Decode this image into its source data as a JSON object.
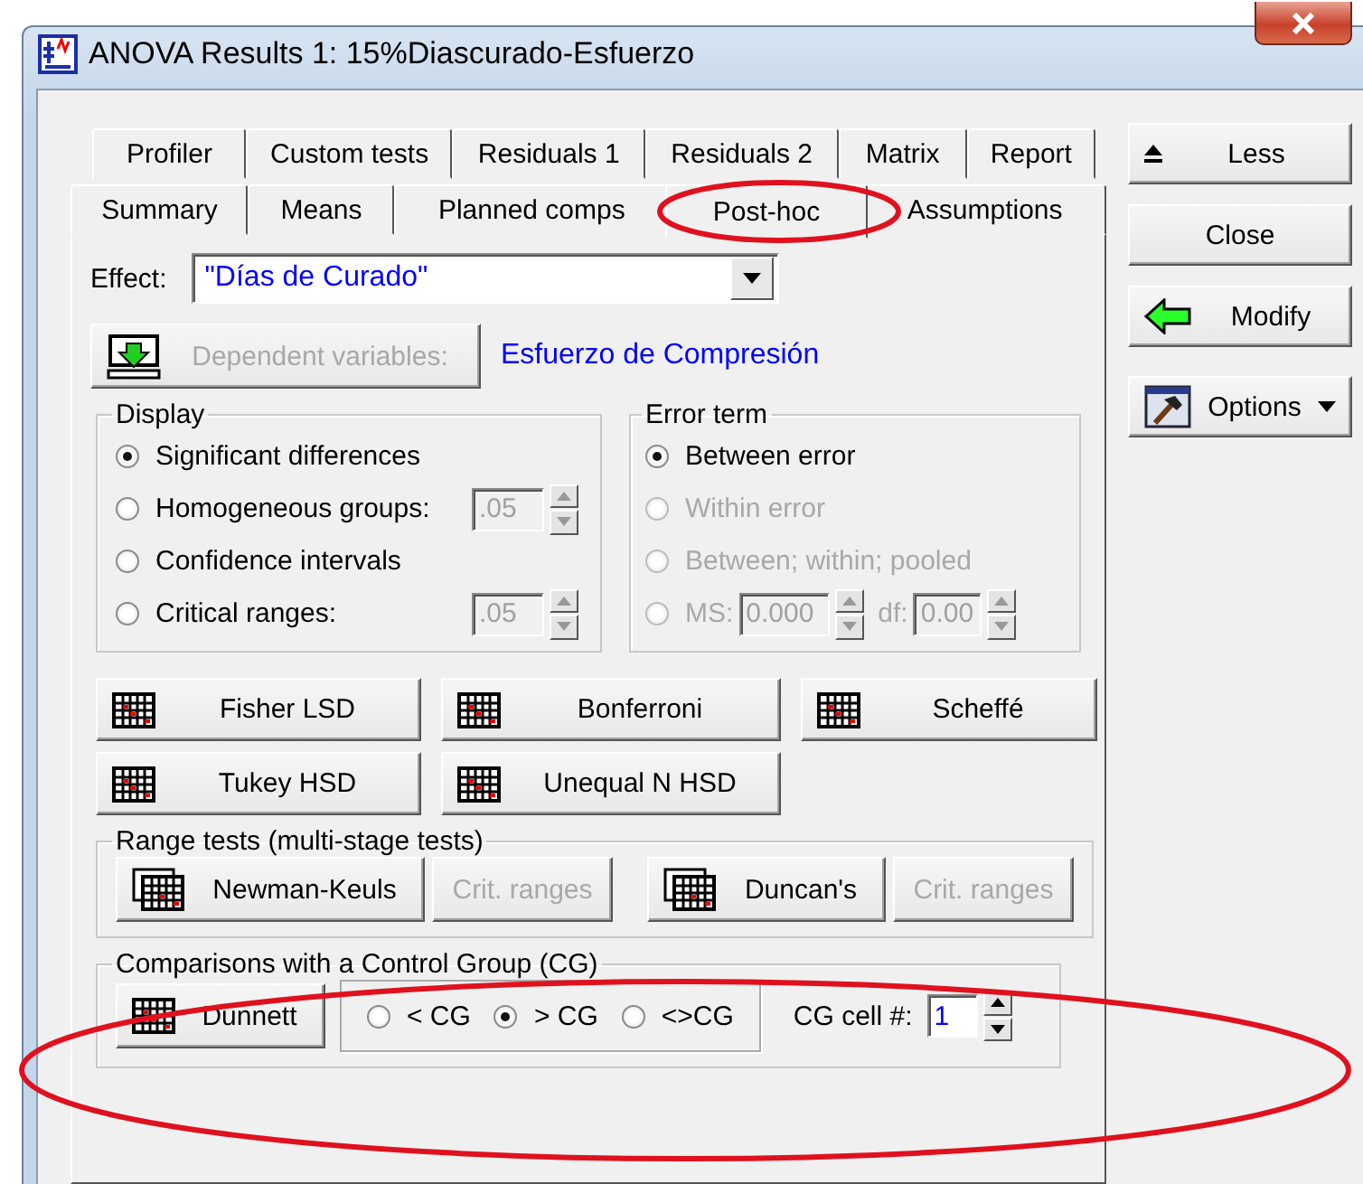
{
  "window": {
    "title": "ANOVA Results 1: 15%Diascurado-Esfuerzo"
  },
  "tab_rows": [
    {
      "tabs": [
        {
          "label": "Profiler",
          "selected": false
        },
        {
          "label": "Custom tests",
          "selected": false
        },
        {
          "label": "Residuals 1",
          "selected": false
        },
        {
          "label": "Residuals 2",
          "selected": false
        },
        {
          "label": "Matrix",
          "selected": false
        },
        {
          "label": "Report",
          "selected": false
        }
      ]
    },
    {
      "tabs": [
        {
          "label": "Summary",
          "selected": false
        },
        {
          "label": "Means",
          "selected": false
        },
        {
          "label": "Planned comps",
          "selected": false
        },
        {
          "label": "Post-hoc",
          "selected": true,
          "circled": true
        },
        {
          "label": "Assumptions",
          "selected": false
        }
      ]
    }
  ],
  "effect": {
    "label": "Effect:",
    "value": "\"Días de Curado\""
  },
  "dependent": {
    "button": "Dependent variables:",
    "disabled": true,
    "value": "Esfuerzo de Compresión"
  },
  "display": {
    "title": "Display",
    "options": [
      {
        "label": "Significant differences",
        "selected": true
      },
      {
        "label": "Homogeneous groups:",
        "selected": false,
        "spin": ".05"
      },
      {
        "label": "Confidence intervals",
        "selected": false
      },
      {
        "label": "Critical ranges:",
        "selected": false,
        "spin": ".05"
      }
    ]
  },
  "error_term": {
    "title": "Error term",
    "options": [
      {
        "label": "Between error",
        "selected": true,
        "disabled": false
      },
      {
        "label": "Within error",
        "selected": false,
        "disabled": true
      },
      {
        "label": "Between; within; pooled",
        "selected": false,
        "disabled": true
      },
      {
        "label": "MS:",
        "selected": false,
        "disabled": true,
        "fields": [
          {
            "value": "0.000"
          },
          {
            "label": "df:",
            "value": "0.00"
          }
        ]
      }
    ]
  },
  "tests": [
    {
      "label": "Fisher LSD"
    },
    {
      "label": "Bonferroni"
    },
    {
      "label": "Scheffé"
    },
    {
      "label": "Tukey HSD"
    },
    {
      "label": "Unequal N HSD"
    }
  ],
  "range_tests": {
    "title": "Range tests (multi-stage tests)",
    "buttons": [
      {
        "label": "Newman-Keuls",
        "disabled": false,
        "kind": "test"
      },
      {
        "label": "Crit. ranges",
        "disabled": true,
        "kind": "plain"
      },
      {
        "label": "Duncan's",
        "disabled": false,
        "kind": "test"
      },
      {
        "label": "Crit. ranges",
        "disabled": true,
        "kind": "plain"
      }
    ]
  },
  "control_group": {
    "title": "Comparisons with a Control Group (CG)",
    "circled": true,
    "button": "Dunnett",
    "options": [
      {
        "label": "< CG",
        "selected": false
      },
      {
        "label": "> CG",
        "selected": true
      },
      {
        "label": "<>CG",
        "selected": false
      }
    ],
    "cell_label": "CG cell #:",
    "cell_value": "1"
  },
  "side_buttons": [
    {
      "label": "Less",
      "kind": "less"
    },
    {
      "label": "Close",
      "kind": "plain"
    },
    {
      "label": "Modify",
      "kind": "modify"
    },
    {
      "label": "Options",
      "kind": "options"
    }
  ]
}
